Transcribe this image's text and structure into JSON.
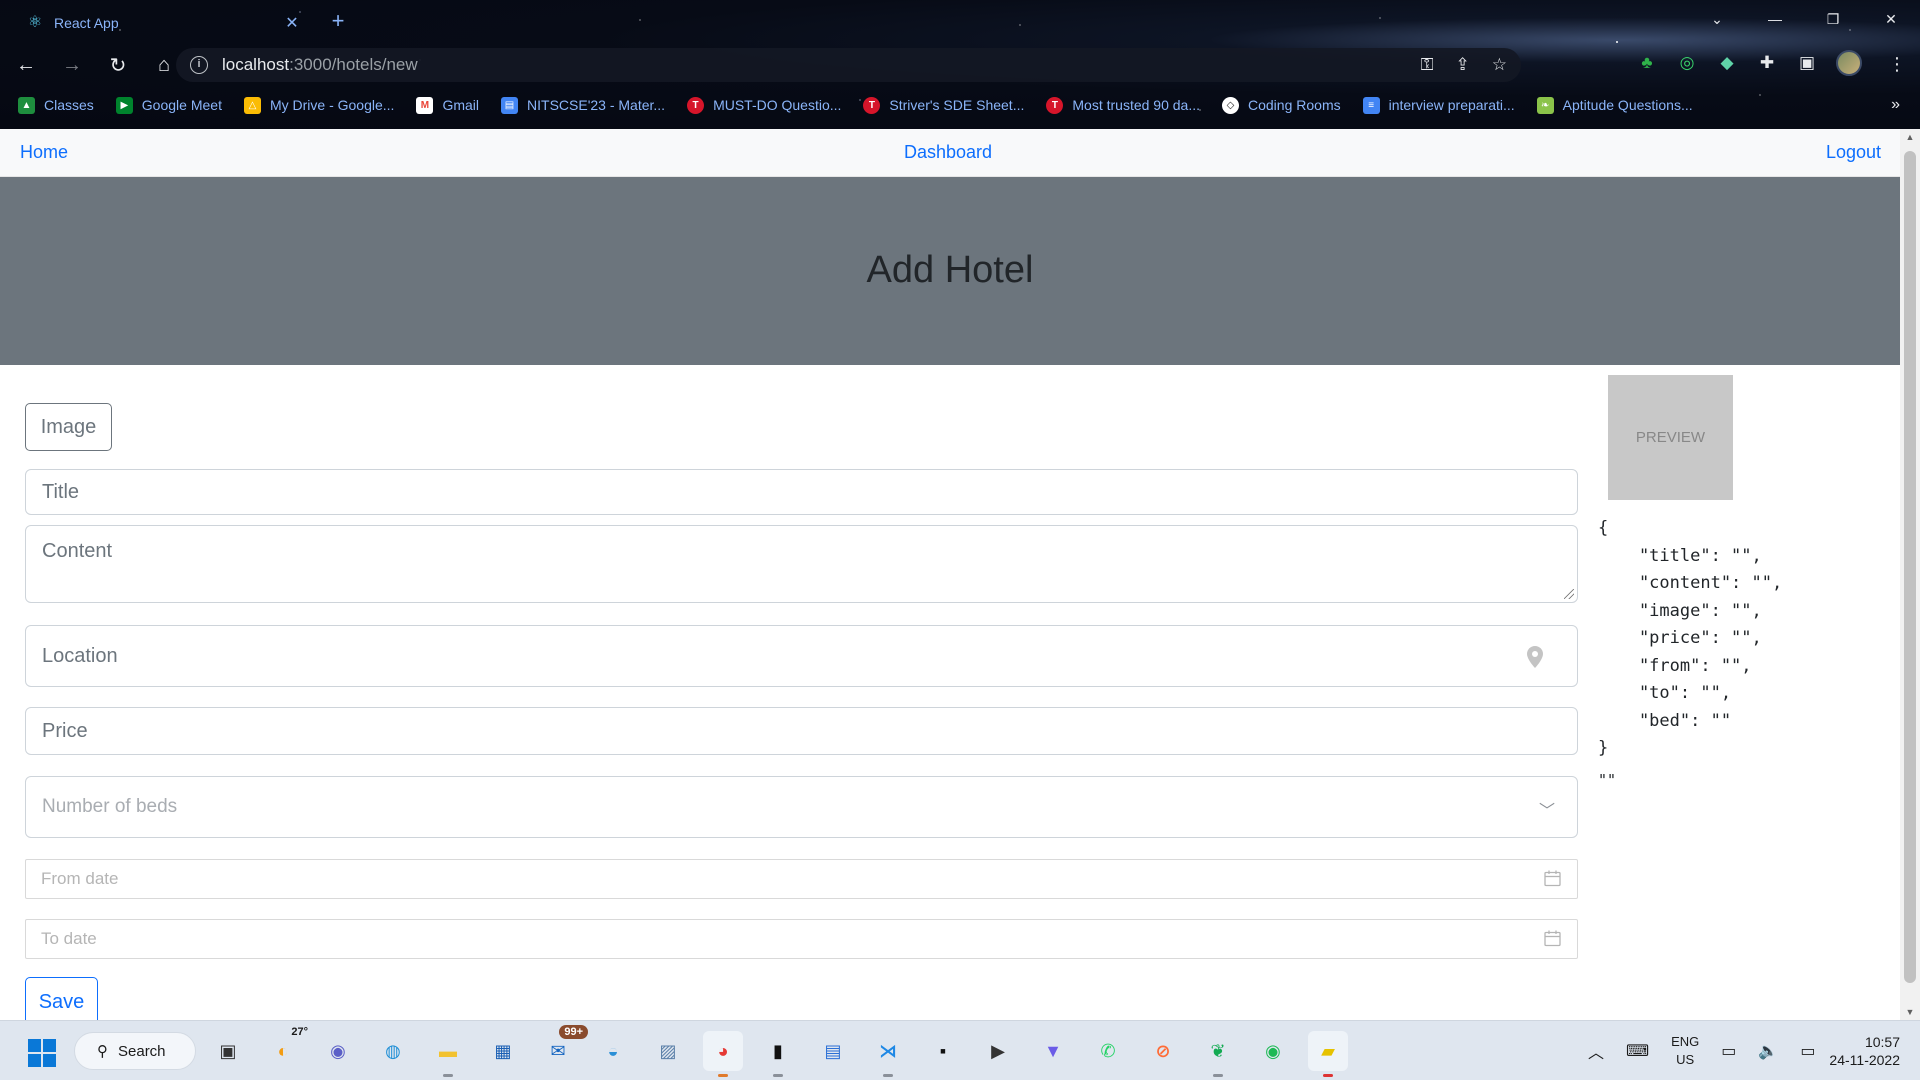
{
  "browser": {
    "tab_title": "React App",
    "url_host": "localhost",
    "url_path": ":3000/hotels/new",
    "bookmarks": [
      {
        "label": "Classes",
        "icon": "classroom-icon",
        "color": "#1e8e3e"
      },
      {
        "label": "Google Meet",
        "icon": "meet-icon",
        "color": "#00832d"
      },
      {
        "label": "My Drive - Google...",
        "icon": "drive-icon",
        "color": "#fbbc04"
      },
      {
        "label": "Gmail",
        "icon": "gmail-icon",
        "color": "#ea4335"
      },
      {
        "label": "NITSCSE'23 - Mater...",
        "icon": "folder-icon",
        "color": "#4285f4"
      },
      {
        "label": "MUST-DO Questio...",
        "icon": "tuf-icon",
        "color": "#d6152a"
      },
      {
        "label": "Striver's SDE Sheet...",
        "icon": "tuf-icon",
        "color": "#d6152a"
      },
      {
        "label": "Most trusted 90 da...",
        "icon": "tuf-icon",
        "color": "#d6152a"
      },
      {
        "label": "Coding Rooms",
        "icon": "coding-rooms-icon",
        "color": "#ffffff"
      },
      {
        "label": "interview preparati...",
        "icon": "docs-icon",
        "color": "#4285f4"
      },
      {
        "label": "Aptitude Questions...",
        "icon": "leaf-icon",
        "color": "#8bc34a"
      }
    ]
  },
  "nav": {
    "home": "Home",
    "dashboard": "Dashboard",
    "logout": "Logout"
  },
  "hero": {
    "title": "Add Hotel"
  },
  "form": {
    "image_button": "Image",
    "title_placeholder": "Title",
    "content_placeholder": "Content",
    "location_placeholder": "Location",
    "price_placeholder": "Price",
    "beds_placeholder": "Number of beds",
    "from_placeholder": "From date",
    "to_placeholder": "To date",
    "save_button": "Save"
  },
  "preview": {
    "label": "PREVIEW",
    "json_dump": "{\n    \"title\": \"\",\n    \"content\": \"\",\n    \"image\": \"\",\n    \"price\": \"\",\n    \"from\": \"\",\n    \"to\": \"\",\n    \"bed\": \"\"\n}",
    "empty_string": "\"\""
  },
  "taskbar": {
    "search_label": "Search",
    "weather": "27°",
    "mail_badge": "99+",
    "lang_top": "ENG",
    "lang_bottom": "US",
    "time": "10:57",
    "date": "24-11-2022"
  },
  "colors": {
    "link": "#0d6efd",
    "hero_bg": "#6c757d",
    "accent": "#8ab4f8"
  }
}
